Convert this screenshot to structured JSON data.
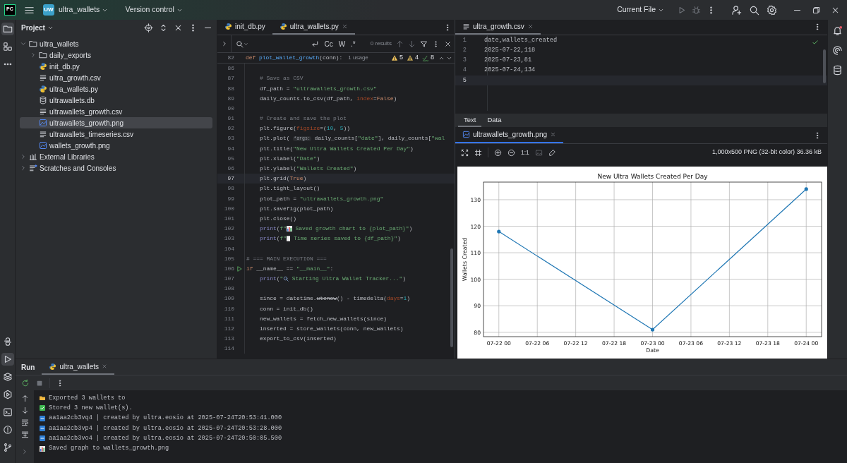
{
  "title_bar": {
    "app_logo": "PC",
    "project_badge": "UW",
    "project": "ultra_wallets",
    "vcs": "Version control",
    "run_config": "Current File"
  },
  "left_toolbar": {
    "top": [
      {
        "kind": "folder",
        "selected": true
      },
      {
        "kind": "structure",
        "selected": false
      },
      {
        "kind": "more",
        "selected": false
      }
    ],
    "bottom": [
      {
        "kind": "python",
        "selected": false
      },
      {
        "kind": "run",
        "selected": true
      },
      {
        "kind": "layers",
        "selected": false
      },
      {
        "kind": "services",
        "selected": false
      },
      {
        "kind": "terminal",
        "selected": false
      },
      {
        "kind": "problems",
        "selected": false
      },
      {
        "kind": "git",
        "selected": false
      }
    ]
  },
  "project_panel": {
    "title": "Project",
    "tree": [
      {
        "label": "ultra_wallets",
        "kind": "folder",
        "expanded": true,
        "selected": false,
        "children": [
          {
            "label": "daily_exports",
            "kind": "folder",
            "expanded": false,
            "selected": false
          },
          {
            "label": "init_db.py",
            "kind": "python",
            "selected": false
          },
          {
            "label": "ultra_growth.csv",
            "kind": "text",
            "selected": false
          },
          {
            "label": "ultra_wallets.py",
            "kind": "python",
            "selected": false
          },
          {
            "label": "ultrawallets.db",
            "kind": "database",
            "selected": false
          },
          {
            "label": "ultrawallets_growth.csv",
            "kind": "text",
            "selected": false
          },
          {
            "label": "ultrawallets_growth.png",
            "kind": "image",
            "selected": true
          },
          {
            "label": "ultrawallets_timeseries.csv",
            "kind": "text",
            "selected": false
          },
          {
            "label": "wallets_growth.png",
            "kind": "image",
            "selected": false
          }
        ]
      },
      {
        "label": "External Libraries",
        "kind": "library",
        "expanded": false,
        "selected": false
      },
      {
        "label": "Scratches and Consoles",
        "kind": "scratches",
        "expanded": false,
        "selected": false
      }
    ]
  },
  "editor": {
    "tabs": [
      {
        "label": "init_db.py",
        "selected": false
      },
      {
        "label": "ultra_wallets.py",
        "selected": true
      }
    ],
    "find_bar": {
      "case_label": "Cc",
      "word_label": "W",
      "regex_label": ".*",
      "results": "0 results"
    },
    "sticky_line": {
      "num": "82",
      "tokens": [
        {
          "kind": "kw",
          "text": "def "
        },
        {
          "kind": "fn",
          "text": "plot_wallet_growth"
        },
        {
          "kind": "plain",
          "text": "(conn):"
        }
      ],
      "usage_hint": "1 usage"
    },
    "inspections": [
      {
        "kind": "warning",
        "count": "5"
      },
      {
        "kind": "weak",
        "count": "4"
      },
      {
        "kind": "typo",
        "count": "8"
      }
    ],
    "lines": [
      {
        "num": "86",
        "current": false,
        "run_gutter": false
      },
      {
        "num": "87",
        "current": false,
        "run_gutter": false,
        "tokens": [
          {
            "kind": "cmt",
            "text": "    # Save as CSV"
          }
        ]
      },
      {
        "num": "88",
        "current": false,
        "run_gutter": false,
        "tokens": [
          {
            "kind": "plain",
            "text": "    df_path = "
          },
          {
            "kind": "str",
            "text": "\"ultrawallets_growth.csv\""
          }
        ]
      },
      {
        "num": "89",
        "current": false,
        "run_gutter": false,
        "tokens": [
          {
            "kind": "plain",
            "text": "    daily_counts.to_csv(df_path, "
          },
          {
            "kind": "param",
            "text": "index"
          },
          {
            "kind": "plain",
            "text": "="
          },
          {
            "kind": "kw",
            "text": "False"
          },
          {
            "kind": "plain",
            "text": ")"
          }
        ]
      },
      {
        "num": "90",
        "current": false,
        "run_gutter": false
      },
      {
        "num": "91",
        "current": false,
        "run_gutter": false,
        "tokens": [
          {
            "kind": "cmt",
            "text": "    # Create and save the plot"
          }
        ]
      },
      {
        "num": "92",
        "current": false,
        "run_gutter": false,
        "tokens": [
          {
            "kind": "plain",
            "text": "    plt.figure("
          },
          {
            "kind": "param",
            "text": "figsize"
          },
          {
            "kind": "plain",
            "text": "=("
          },
          {
            "kind": "num",
            "text": "10"
          },
          {
            "kind": "plain",
            "text": ", "
          },
          {
            "kind": "num",
            "text": "5"
          },
          {
            "kind": "plain",
            "text": "))"
          }
        ]
      },
      {
        "num": "93",
        "current": false,
        "run_gutter": false,
        "tokens": [
          {
            "kind": "plain",
            "text": "    plt.plot( "
          },
          {
            "kind": "hint",
            "text": "*args:"
          },
          {
            "kind": "plain",
            "text": " daily_counts["
          },
          {
            "kind": "str",
            "text": "\"date\""
          },
          {
            "kind": "plain",
            "text": "], daily_counts["
          },
          {
            "kind": "str",
            "text": "\"wal"
          }
        ]
      },
      {
        "num": "94",
        "current": false,
        "run_gutter": false,
        "tokens": [
          {
            "kind": "plain",
            "text": "    plt.title("
          },
          {
            "kind": "str",
            "text": "\"New Ultra Wallets Created Per Day\""
          },
          {
            "kind": "plain",
            "text": ")"
          }
        ]
      },
      {
        "num": "95",
        "current": false,
        "run_gutter": false,
        "tokens": [
          {
            "kind": "plain",
            "text": "    plt.xlabel("
          },
          {
            "kind": "str",
            "text": "\"Date\""
          },
          {
            "kind": "plain",
            "text": ")"
          }
        ]
      },
      {
        "num": "96",
        "current": false,
        "run_gutter": false,
        "tokens": [
          {
            "kind": "plain",
            "text": "    plt.ylabel("
          },
          {
            "kind": "str",
            "text": "\"Wallets Created\""
          },
          {
            "kind": "plain",
            "text": ")"
          }
        ]
      },
      {
        "num": "97",
        "current": true,
        "run_gutter": false,
        "tokens": [
          {
            "kind": "plain",
            "text": "    plt.grid("
          },
          {
            "kind": "kw",
            "text": "True"
          },
          {
            "kind": "plain",
            "text": ")"
          }
        ]
      },
      {
        "num": "98",
        "current": false,
        "run_gutter": false,
        "tokens": [
          {
            "kind": "plain",
            "text": "    plt.tight_layout()"
          }
        ]
      },
      {
        "num": "99",
        "current": false,
        "run_gutter": false,
        "tokens": [
          {
            "kind": "plain",
            "text": "    plot_path = "
          },
          {
            "kind": "str",
            "text": "\"ultrawallets_growth.png\""
          }
        ]
      },
      {
        "num": "100",
        "current": false,
        "run_gutter": false,
        "tokens": [
          {
            "kind": "plain",
            "text": "    plt.savefig(plot_path)"
          }
        ]
      },
      {
        "num": "101",
        "current": false,
        "run_gutter": false,
        "tokens": [
          {
            "kind": "plain",
            "text": "    plt.close()"
          }
        ]
      },
      {
        "num": "102",
        "current": false,
        "run_gutter": false,
        "tokens": [
          {
            "kind": "builtin",
            "text": "    print"
          },
          {
            "kind": "plain",
            "text": "("
          },
          {
            "kind": "str",
            "text": "f\""
          },
          {
            "kind": "chart"
          },
          {
            "kind": "str",
            "text": " Saved growth chart to {plot_path}\""
          },
          {
            "kind": "plain",
            "text": ")"
          }
        ]
      },
      {
        "num": "103",
        "current": false,
        "run_gutter": false,
        "tokens": [
          {
            "kind": "builtin",
            "text": "    print"
          },
          {
            "kind": "plain",
            "text": "("
          },
          {
            "kind": "str",
            "text": "f\""
          },
          {
            "kind": "page"
          },
          {
            "kind": "str",
            "text": " Time series saved to {df_path}\""
          },
          {
            "kind": "plain",
            "text": ")"
          }
        ]
      },
      {
        "num": "104",
        "current": false,
        "run_gutter": false
      },
      {
        "num": "105",
        "current": false,
        "run_gutter": false,
        "tokens": [
          {
            "kind": "cmt",
            "text": "# === MAIN EXECUTION ==="
          }
        ]
      },
      {
        "num": "106",
        "current": false,
        "run_gutter": true,
        "tokens": [
          {
            "kind": "kw",
            "text": "if "
          },
          {
            "kind": "plain",
            "text": "__name__ == "
          },
          {
            "kind": "str",
            "text": "\"__main__\""
          },
          {
            "kind": "plain",
            "text": ":"
          }
        ]
      },
      {
        "num": "107",
        "current": false,
        "run_gutter": false,
        "tokens": [
          {
            "kind": "builtin",
            "text": "    print"
          },
          {
            "kind": "plain",
            "text": "("
          },
          {
            "kind": "str",
            "text": "\""
          },
          {
            "kind": "magnifier"
          },
          {
            "kind": "str",
            "text": " Starting Ultra Wallet Tracker...\""
          },
          {
            "kind": "plain",
            "text": ")"
          }
        ]
      },
      {
        "num": "108",
        "current": false,
        "run_gutter": false
      },
      {
        "num": "109",
        "current": false,
        "run_gutter": false,
        "tokens": [
          {
            "kind": "plain",
            "text": "    since = datetime."
          },
          {
            "kind": "deprecated",
            "text": "utcnow"
          },
          {
            "kind": "plain",
            "text": "() - timedelta("
          },
          {
            "kind": "param",
            "text": "days"
          },
          {
            "kind": "plain",
            "text": "="
          },
          {
            "kind": "num",
            "text": "1"
          },
          {
            "kind": "plain",
            "text": ")"
          }
        ]
      },
      {
        "num": "110",
        "current": false,
        "run_gutter": false,
        "tokens": [
          {
            "kind": "plain",
            "text": "    conn = init_db()"
          }
        ]
      },
      {
        "num": "111",
        "current": false,
        "run_gutter": false,
        "tokens": [
          {
            "kind": "plain",
            "text": "    new_wallets = fetch_new_wallets(since)"
          }
        ]
      },
      {
        "num": "112",
        "current": false,
        "run_gutter": false,
        "tokens": [
          {
            "kind": "plain",
            "text": "    inserted = store_wallets(conn, new_wallets)"
          }
        ]
      },
      {
        "num": "113",
        "current": false,
        "run_gutter": false,
        "tokens": [
          {
            "kind": "plain",
            "text": "    export_to_csv(inserted)"
          }
        ]
      },
      {
        "num": "114",
        "current": false,
        "run_gutter": false
      }
    ]
  },
  "csv_editor": {
    "tab": "ultra_growth.csv",
    "lines": [
      {
        "num": "1",
        "current": false,
        "text": "date,wallets_created"
      },
      {
        "num": "2",
        "current": false,
        "text": "2025-07-22,118"
      },
      {
        "num": "3",
        "current": false,
        "text": "2025-07-23,81"
      },
      {
        "num": "4",
        "current": false,
        "text": "2025-07-24,134"
      },
      {
        "num": "5",
        "current": true
      }
    ],
    "view_tabs": [
      {
        "label": "Text",
        "selected": true
      },
      {
        "label": "Data",
        "selected": false
      }
    ]
  },
  "image_viewer": {
    "tab": "ultrawallets_growth.png",
    "zoom_label": "1:1",
    "info": "1,000x500 PNG (32-bit color) 36.36 kB",
    "chart_data": {
      "type": "line",
      "grid": true,
      "title": "New Ultra Wallets Created Per Day",
      "xlabel": "Date",
      "ylabel": "Wallets Created",
      "categories": [
        "07-22 00",
        "07-22 06",
        "07-22 12",
        "07-22 18",
        "07-23 00",
        "07-23 06",
        "07-23 12",
        "07-23 18",
        "07-24 00"
      ],
      "series": [
        {
          "color": "#1f77b4",
          "values": [
            118,
            null,
            null,
            null,
            81,
            null,
            null,
            null,
            134
          ]
        }
      ],
      "ylim": [
        78.35,
        136.65
      ],
      "yticks": [
        80,
        90,
        100,
        110,
        120,
        130
      ]
    }
  },
  "run_panel": {
    "title": "Run",
    "tabs": [
      {
        "label": "ultra_wallets",
        "selected": true
      }
    ],
    "output": [
      {
        "kind": "folder",
        "text": "Exported 3 wallets to"
      },
      {
        "kind": "check",
        "text": "Stored 3 new wallet(s)."
      },
      {
        "kind": "new",
        "text": "aa1aa2cb3vq4 | created by ultra.eosio at 2025-07-24T20:53:41.000"
      },
      {
        "kind": "new",
        "text": "aa1aa2cb3vp4 | created by ultra.eosio at 2025-07-24T20:53:28.000"
      },
      {
        "kind": "new",
        "text": "aa1aa2cb3vo4 | created by ultra.eosio at 2025-07-24T20:50:05.500"
      },
      {
        "kind": "chart",
        "text": "Saved graph to wallets_growth.png"
      }
    ]
  }
}
